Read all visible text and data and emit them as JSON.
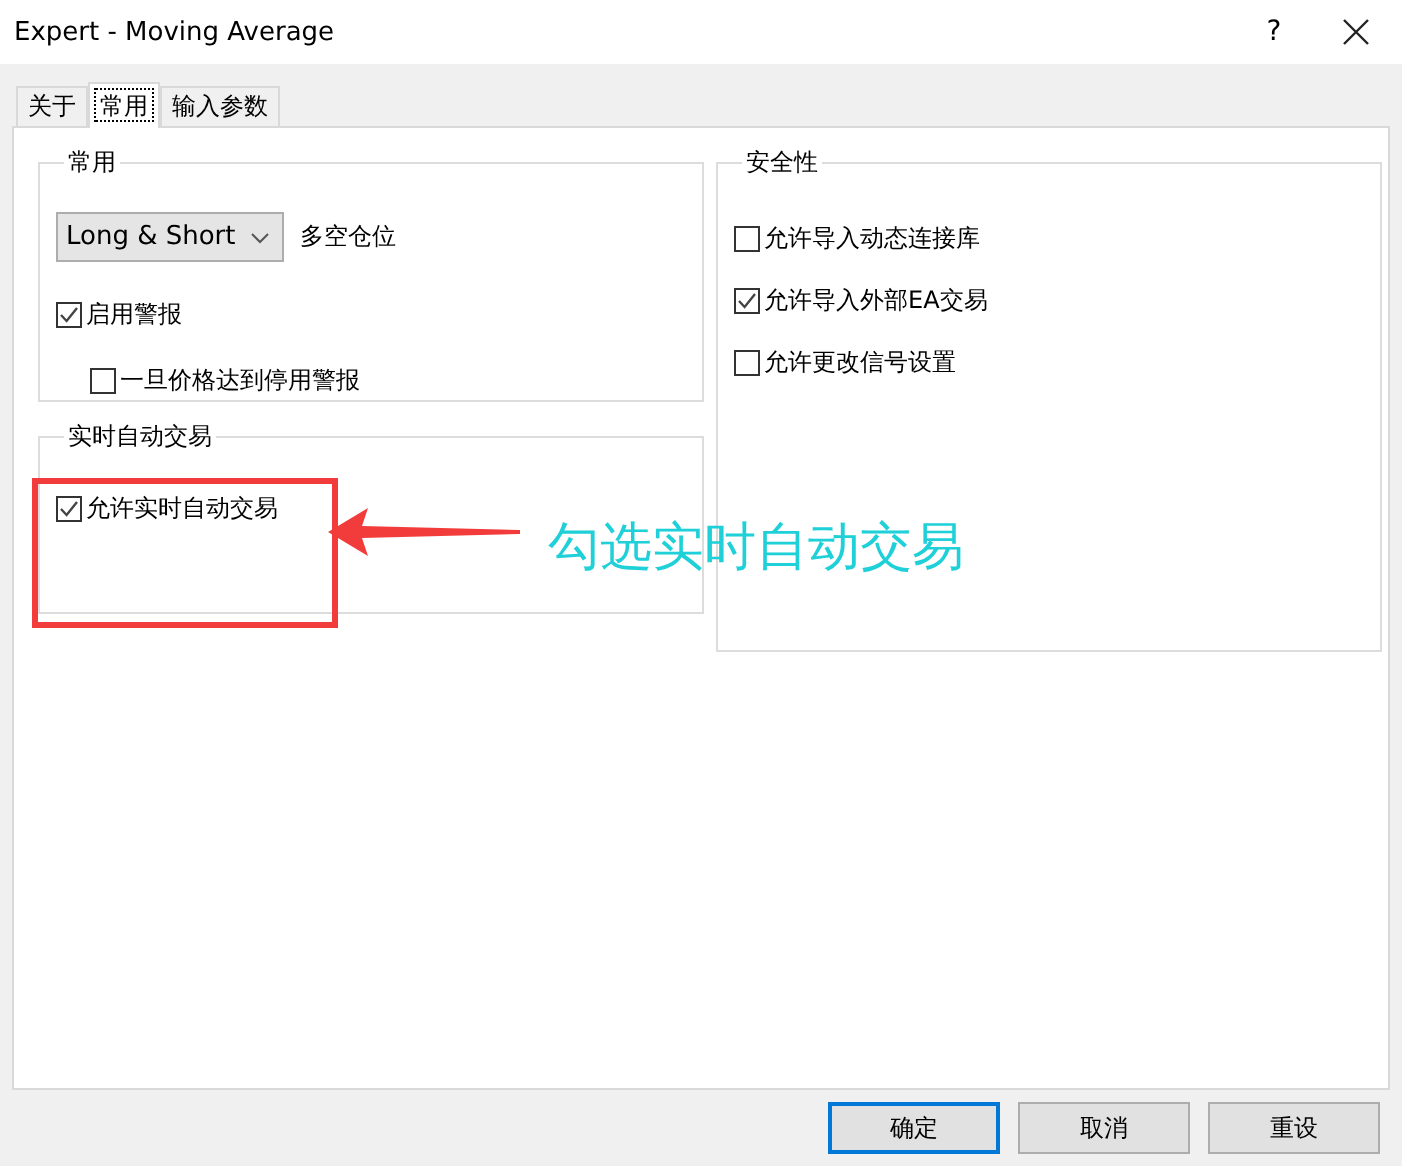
{
  "window": {
    "title": "Expert - Moving Average",
    "help": "?"
  },
  "tabs": [
    {
      "label": "关于",
      "selected": false
    },
    {
      "label": "常用",
      "selected": true
    },
    {
      "label": "输入参数",
      "selected": false
    }
  ],
  "general": {
    "title": "常用",
    "position_dropdown": {
      "value": "Long & Short"
    },
    "position_label": "多空仓位",
    "options": [
      {
        "label": "启用警报",
        "checked": true,
        "children": [
          {
            "label": "一旦价格达到停用警报",
            "checked": false
          }
        ]
      }
    ]
  },
  "live_trading": {
    "title": "实时自动交易",
    "options": [
      {
        "label": "允许实时自动交易",
        "checked": true
      }
    ]
  },
  "safety": {
    "title": "安全性",
    "options": [
      {
        "label": "允许导入动态连接库",
        "checked": false
      },
      {
        "label": "允许导入外部EA交易",
        "checked": true
      },
      {
        "label": "允许更改信号设置",
        "checked": false
      }
    ]
  },
  "buttons": [
    {
      "label": "确定",
      "selected": true
    },
    {
      "label": "取消",
      "selected": false
    },
    {
      "label": "重设",
      "selected": false
    }
  ],
  "annotation": {
    "text": "勾选实时自动交易"
  }
}
